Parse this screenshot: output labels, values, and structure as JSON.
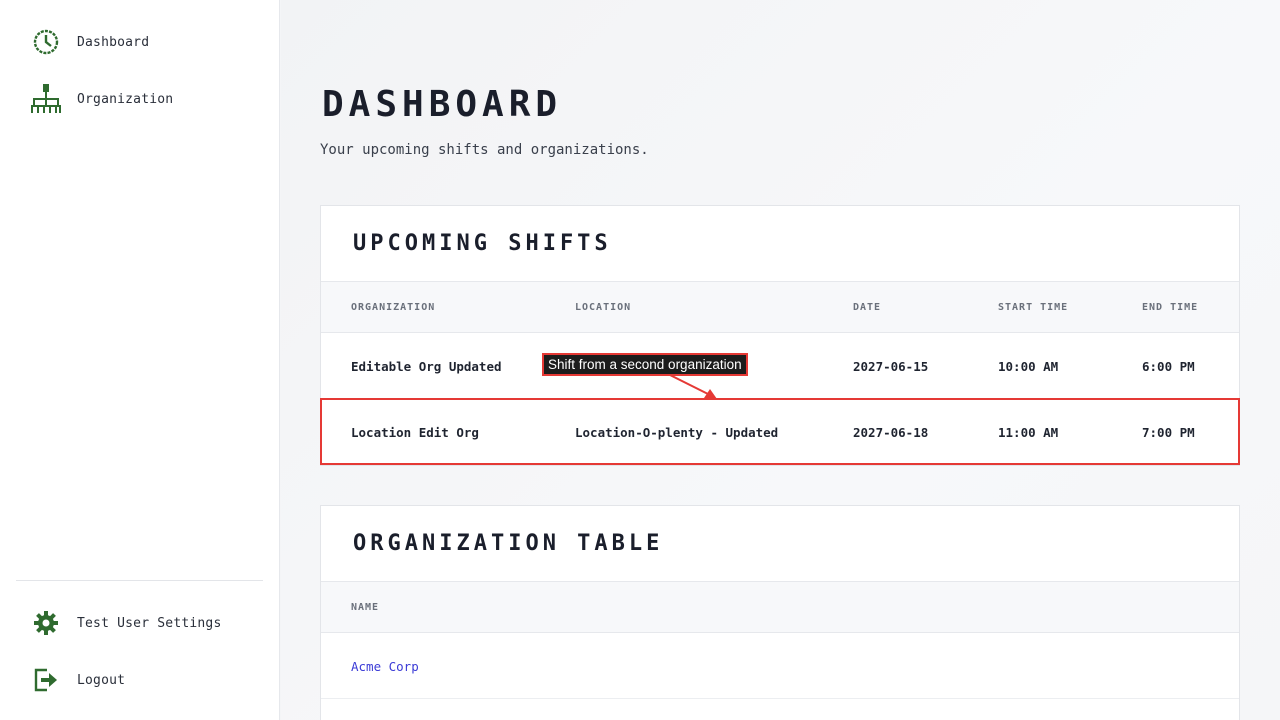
{
  "sidebar": {
    "items": [
      {
        "label": "Dashboard",
        "icon": "clock-icon"
      },
      {
        "label": "Organization",
        "icon": "org-chart-icon"
      }
    ],
    "bottom_items": [
      {
        "label": "Test User Settings",
        "icon": "gear-icon"
      },
      {
        "label": "Logout",
        "icon": "logout-icon"
      }
    ]
  },
  "header": {
    "title": "Dashboard",
    "subtitle": "Your upcoming shifts and organizations."
  },
  "shifts": {
    "title": "Upcoming Shifts",
    "columns": [
      "Organization",
      "Location",
      "Date",
      "Start Time",
      "End Time"
    ],
    "rows": [
      [
        "Editable Org Updated",
        "",
        "2027-06-15",
        "10:00 AM",
        "6:00 PM"
      ],
      [
        "Location Edit Org",
        "Location-O-plenty - Updated",
        "2027-06-18",
        "11:00 AM",
        "7:00 PM"
      ]
    ]
  },
  "orgs": {
    "title": "Organization Table",
    "columns": [
      "Name"
    ],
    "rows": [
      [
        "Acme Corp"
      ]
    ]
  },
  "annotation": {
    "text": "Shift from a second organization"
  },
  "colors": {
    "icon_green": "#2f6b2f",
    "highlight_red": "#e53935",
    "link_blue": "#3b3bd6"
  }
}
